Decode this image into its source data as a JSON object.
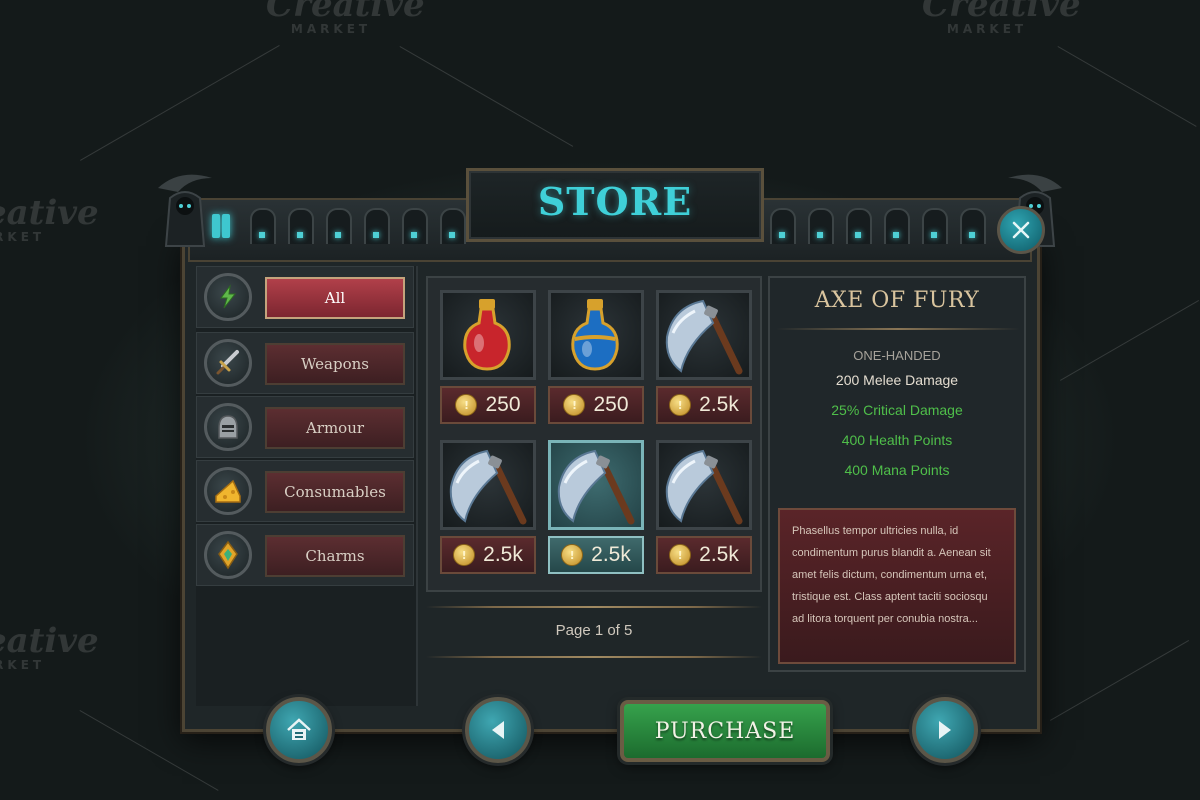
{
  "watermark": {
    "brand": "Creative",
    "sub": "MARKET"
  },
  "store": {
    "title": "STORE"
  },
  "categories": [
    {
      "label": "All",
      "icon": "lightning-icon",
      "active": true
    },
    {
      "label": "Weapons",
      "icon": "sword-icon",
      "active": false
    },
    {
      "label": "Armour",
      "icon": "helmet-icon",
      "active": false
    },
    {
      "label": "Consumables",
      "icon": "cheese-icon",
      "active": false
    },
    {
      "label": "Charms",
      "icon": "amulet-icon",
      "active": false
    }
  ],
  "items": [
    {
      "icon": "red-potion-icon",
      "price": "250",
      "selected": false
    },
    {
      "icon": "blue-potion-icon",
      "price": "250",
      "selected": false
    },
    {
      "icon": "axe-icon",
      "price": "2.5k",
      "selected": false
    },
    {
      "icon": "axe-icon",
      "price": "2.5k",
      "selected": false
    },
    {
      "icon": "axe-icon",
      "price": "2.5k",
      "selected": true
    },
    {
      "icon": "axe-icon",
      "price": "2.5k",
      "selected": false
    }
  ],
  "pager": {
    "text": "Page 1 of 5"
  },
  "detail": {
    "title": "AXE OF FURY",
    "type": "ONE-HANDED",
    "stats": [
      {
        "text": "200 Melee Damage",
        "color": "#e4ddd0"
      },
      {
        "text": "25% Critical Damage",
        "color": "#4fbf4a"
      },
      {
        "text": "400 Health Points",
        "color": "#4fbf4a"
      },
      {
        "text": "400 Mana Points",
        "color": "#4fbf4a"
      }
    ],
    "description": "Phasellus tempor ultricies nulla, id condimentum purus blandit a. Aenean sit amet felis dictum, condimentum urna et, tristique est. Class aptent taciti sociosqu ad litora torquent per conubia nostra..."
  },
  "buttons": {
    "purchase": "PURCHASE",
    "home_icon": "home-icon",
    "prev_icon": "arrow-left-icon",
    "next_icon": "arrow-right-icon",
    "close_icon": "close-icon"
  }
}
